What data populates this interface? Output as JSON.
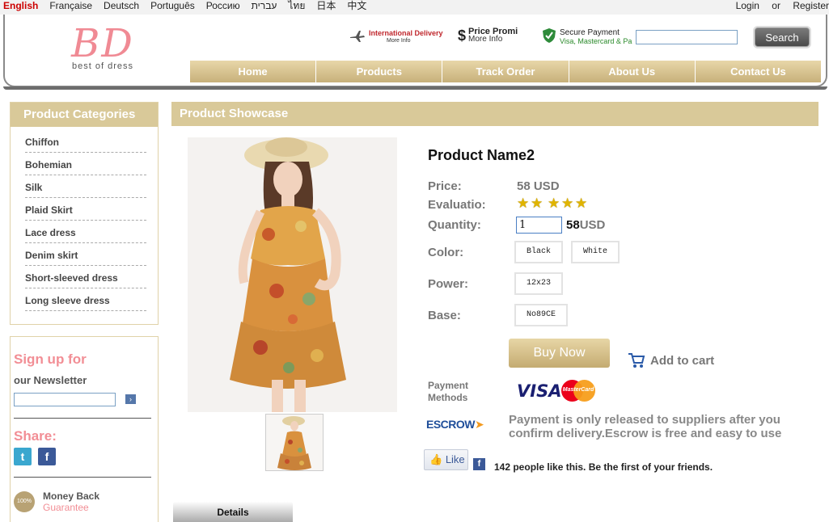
{
  "langbar": {
    "languages": [
      "English",
      "Française",
      "Deutsch",
      "Português",
      "Россию",
      "עברית",
      "ไทย",
      "日本",
      "中文"
    ],
    "login": "Login",
    "or": "or",
    "register": "Register"
  },
  "header": {
    "logo_letters": "BD",
    "logo_tagline": "best of dress",
    "intl_title": "International Delivery",
    "intl_sub": "More Info",
    "price_symbol": "$",
    "price_title": "Price Promi",
    "price_sub": "More Info",
    "secure_title": "Secure Payment",
    "secure_sub": "Visa, Mastercard & Pa",
    "search_button": "Search",
    "search_value": ""
  },
  "nav": {
    "items": [
      "Home",
      "Products",
      "Track Order",
      "About Us",
      "Contact Us"
    ]
  },
  "sidebar": {
    "categories_title": "Product Categories",
    "categories": [
      "Chiffon",
      "Bohemian",
      "Silk",
      "Plaid Skirt",
      "Lace dress",
      "Denim skirt",
      "Short-sleeved dress",
      "Long sleeve dress"
    ],
    "newsletter_title": "Sign up for",
    "newsletter_sub": "our Newsletter",
    "newsletter_value": "",
    "share_title": "Share:",
    "money_badge": "100%",
    "money_title": "Money Back",
    "money_sub": "Guarantee"
  },
  "showcase": {
    "title": "Product Showcase",
    "product_name": "Product Name2",
    "price_label": "Price:",
    "price_value": "58 USD",
    "evaluation_label": "Evaluatio:",
    "rating": 5,
    "quantity_label": "Quantity:",
    "quantity_value": "1",
    "total_number": "58",
    "total_unit": "USD",
    "color_label": "Color:",
    "colors": [
      "Black",
      "White"
    ],
    "power_label": "Power:",
    "power_option": "12x23",
    "base_label": "Base:",
    "base_option": "No89CE",
    "buy_button": "Buy Now",
    "cart_label": "Add to cart",
    "payment_label": "Payment Methods",
    "visa_text": "VISA",
    "mastercard_text": "MasterCard",
    "escrow_logo": "ESCROW",
    "escrow_text": "Payment is only released to suppliers after you confirm delivery.Escrow is free and easy to use",
    "like_button": "Like",
    "like_text": "142 people like this. Be the first of your friends.",
    "details_tab": "Details"
  }
}
